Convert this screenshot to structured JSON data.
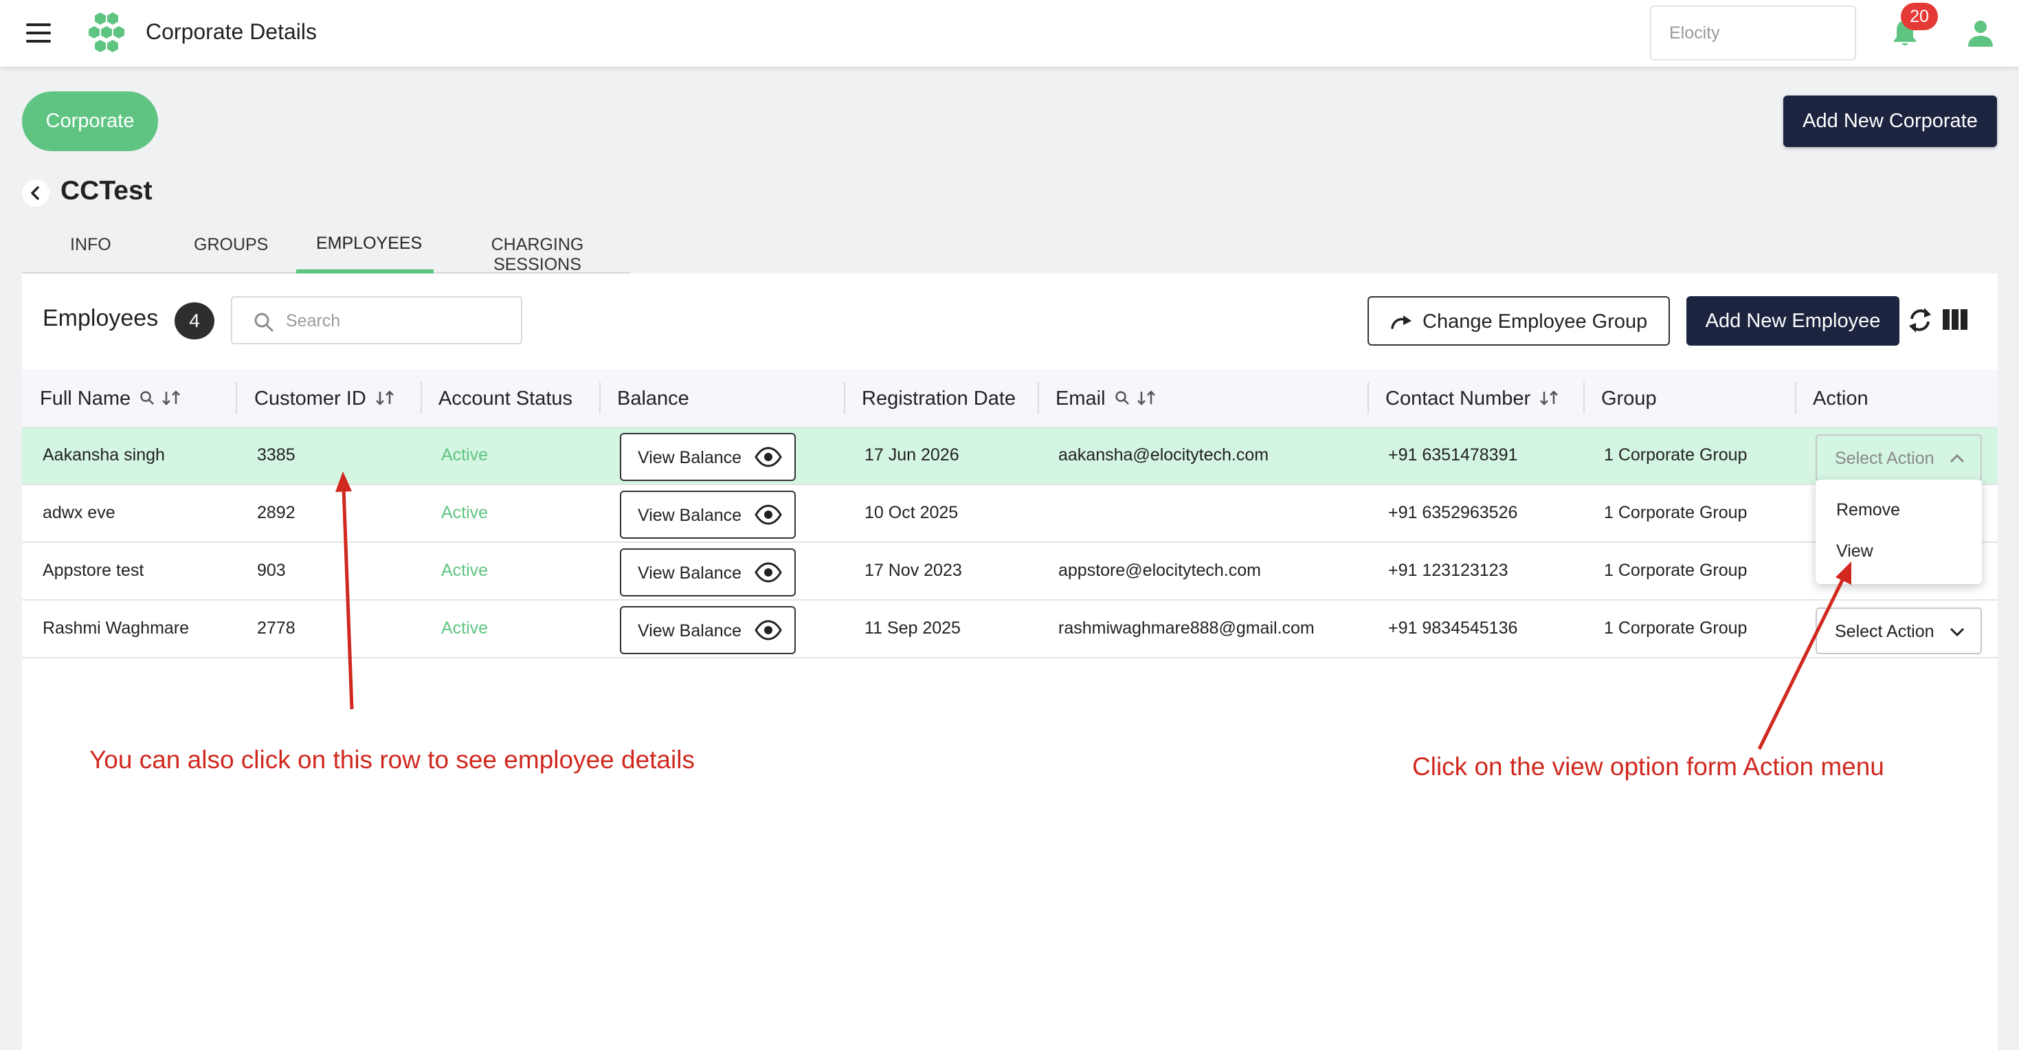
{
  "header": {
    "title": "Corporate Details",
    "org_selector": "Elocity",
    "notification_count": "20",
    "icons": [
      "hamburger-menu-icon",
      "hexagon-logo-icon",
      "bell-icon",
      "user-icon"
    ]
  },
  "page": {
    "corporate_pill": "Corporate",
    "add_corporate_label": "Add New Corporate",
    "entity_name": "CCTest"
  },
  "tabs": [
    {
      "label": "INFO",
      "active": false
    },
    {
      "label": "GROUPS",
      "active": false
    },
    {
      "label": "EMPLOYEES",
      "active": true
    },
    {
      "label": "CHARGING SESSIONS",
      "active": false
    }
  ],
  "employees": {
    "title": "Employees",
    "count": "4",
    "search_placeholder": "Search",
    "change_group_label": "Change Employee Group",
    "add_employee_label": "Add New Employee"
  },
  "table": {
    "columns": [
      "Full Name",
      "Customer ID",
      "Account Status",
      "Balance",
      "Registration Date",
      "Email",
      "Contact Number",
      "Group",
      "Action"
    ],
    "rows": [
      {
        "name": "Aakansha singh",
        "customer_id": "3385",
        "status": "Active",
        "balance": "View Balance",
        "registration_date": "17 Jun 2026",
        "email": "aakansha@elocitytech.com",
        "contact": "+91 6351478391",
        "group": "1 Corporate Group",
        "action": "Select Action"
      },
      {
        "name": "adwx eve",
        "customer_id": "2892",
        "status": "Active",
        "balance": "View Balance",
        "registration_date": "10 Oct 2025",
        "email": "",
        "contact": "+91 6352963526",
        "group": "1 Corporate Group",
        "action": "Select Action"
      },
      {
        "name": "Appstore test",
        "customer_id": "903",
        "status": "Active",
        "balance": "View Balance",
        "registration_date": "17 Nov 2023",
        "email": "appstore@elocitytech.com",
        "contact": "+91 123123123",
        "group": "1 Corporate Group",
        "action": "Select Action"
      },
      {
        "name": "Rashmi Waghmare",
        "customer_id": "2778",
        "status": "Active",
        "balance": "View Balance",
        "registration_date": "11 Sep 2025",
        "email": "rashmiwaghmare888@gmail.com",
        "contact": "+91 9834545136",
        "group": "1 Corporate Group",
        "action": "Select Action"
      }
    ]
  },
  "action_menu": {
    "items": [
      "Remove",
      "View"
    ]
  },
  "annotations": {
    "row_hint": "You can also click on this row to see employee details",
    "action_hint": "Click on the view option form Action menu",
    "color": "#d0281e"
  },
  "colors": {
    "accent_green": "#5fc482",
    "dark_navy": "#1d2440",
    "row_highlight": "#d4f5e2",
    "badge_red": "#e53935"
  }
}
